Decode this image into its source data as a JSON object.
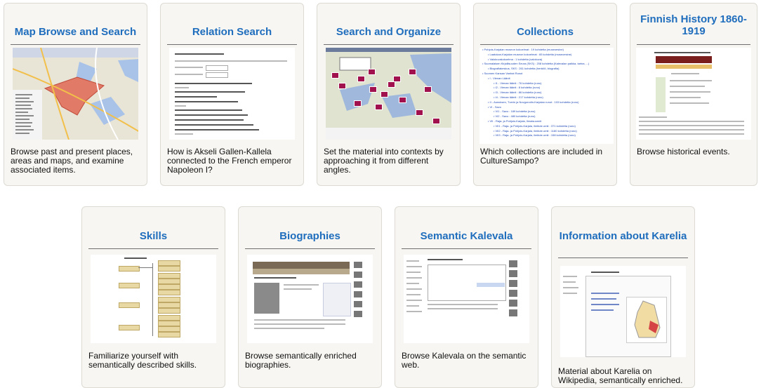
{
  "cards_row1": [
    {
      "title": "Map Browse and Search",
      "description": "Browse past and present places, areas and maps, and examine associated items."
    },
    {
      "title": "Relation Search",
      "description": "How is Akseli Gallen-Kallela connected to the French emperor Napoleon I?"
    },
    {
      "title": "Search and Organize",
      "description": "Set the material into contexts by approaching it from different angles."
    },
    {
      "title": "Collections",
      "description": "Which collections are included in CultureSampo?"
    },
    {
      "title": "Finnish History 1860-1919",
      "description": "Browse historical events."
    }
  ],
  "cards_row2": [
    {
      "title": "Skills",
      "description": "Familiarize yourself with semantically described skills."
    },
    {
      "title": "Biographies",
      "description": "Browse semantically enriched biographies."
    },
    {
      "title": "Semantic Kalevala",
      "description": "Browse Kalevala on the semantic web."
    },
    {
      "title": "Information about Karelia",
      "description": "Material about Karelia on Wikipedia, semantically enriched."
    }
  ],
  "colors": {
    "title": "#1f6dbd",
    "card_bg": "#f7f6f2",
    "border": "#dcdad2"
  },
  "collections_list": [
    "Pohjois-Karjalan museon kokoelmat : 19 kohdetta (museoesine)",
    "Laatokan-Karjalan museon kokoelmat : 65 kohdetta (museoesine)",
    "Valokuvakokoelma : 1 kohdetta (valokuva)",
    "Suomalaisen Kirjallisuuden Seura (SKS) : 208 kohdetta (Kalevalan paikka, tarina, ...)",
    "Biografiakeskus, SKS : 261 kohdetta (henkilö, biografia)",
    "Suomen Kansan Vanhat Runot",
    "I - Vienan Läänit",
    "I1 - Vienan läänit : 76 kohdetta (runo)",
    "I2 - Vienan läänit : 8 kohdetta (runo)",
    "I3 - Vienan läänit : 86 kohdetta (runo)",
    "I4 - Vienan läänit : 217 kohdetta (runo)",
    "II - Aunuksen, Tverin ja Novgorodin-Karjalan runot : 103 kohdetta (runo)",
    "VI - Savo",
    "VI1 - Savo : 189 kohdetta (runo)",
    "VI2 - Savo : 480 kohdetta (runo)",
    "VII - Raja- ja Pohjois-Karjala, Ilmaisuunnit",
    "VII1 - Raja- ja Pohjois-Karjala, ilmitute.omit : 371 kohdetta (runo)",
    "VII2 - Raja- ja Pohjois-Karjala, ilmitute.omit : 1180 kohdetta (runo)",
    "VII3 - Raja- ja Pohjois-Karjala, ilmitute.omit : 158 kohdetta (runo)"
  ]
}
